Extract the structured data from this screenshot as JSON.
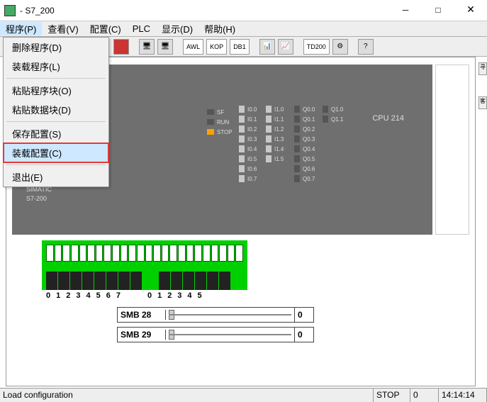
{
  "window": {
    "title": " - S7_200"
  },
  "menubar": {
    "program": "程序(P)",
    "view": "查看(V)",
    "config": "配置(C)",
    "plc": "PLC",
    "display": "显示(D)",
    "help": "帮助(H)"
  },
  "dropdown": {
    "delete_program": "删除程序(D)",
    "load_program": "装载程序(L)",
    "paste_block": "粘贴程序块(O)",
    "paste_data": "粘贴数据块(D)",
    "save_config": "保存配置(S)",
    "load_config": "装载配置(C)",
    "exit": "退出(E)"
  },
  "toolbar": {
    "awl": "AWL",
    "kop": "KOP",
    "db1": "DB1",
    "td200": "TD200"
  },
  "plc": {
    "brand": "SIMATIC",
    "model": "S7-200",
    "cpu": "CPU 214",
    "status": {
      "sf": "SF",
      "run": "RUN",
      "stop": "STOP"
    },
    "io": {
      "i0": [
        "I0.0",
        "I0.1",
        "I0.2",
        "I0.3",
        "I0.4",
        "I0.5",
        "I0.6",
        "I0.7"
      ],
      "i1": [
        "I1.0",
        "I1.1",
        "I1.2",
        "I1.3",
        "I1.4",
        "I1.5"
      ],
      "q0": [
        "Q0.0",
        "Q0.1",
        "Q0.2",
        "Q0.3",
        "Q0.4",
        "Q0.5",
        "Q0.6",
        "Q0.7"
      ],
      "q1": [
        "Q1.0",
        "Q1.1"
      ]
    }
  },
  "terminals": {
    "labels1": "01234567",
    "labels2": "012345"
  },
  "smb": {
    "smb28": {
      "label": "SMB 28",
      "value": "0"
    },
    "smb29": {
      "label": "SMB 29",
      "value": "0"
    }
  },
  "statusbar": {
    "msg": "Load configuration",
    "mode": "STOP",
    "val": "0",
    "time": "14:14:14"
  }
}
